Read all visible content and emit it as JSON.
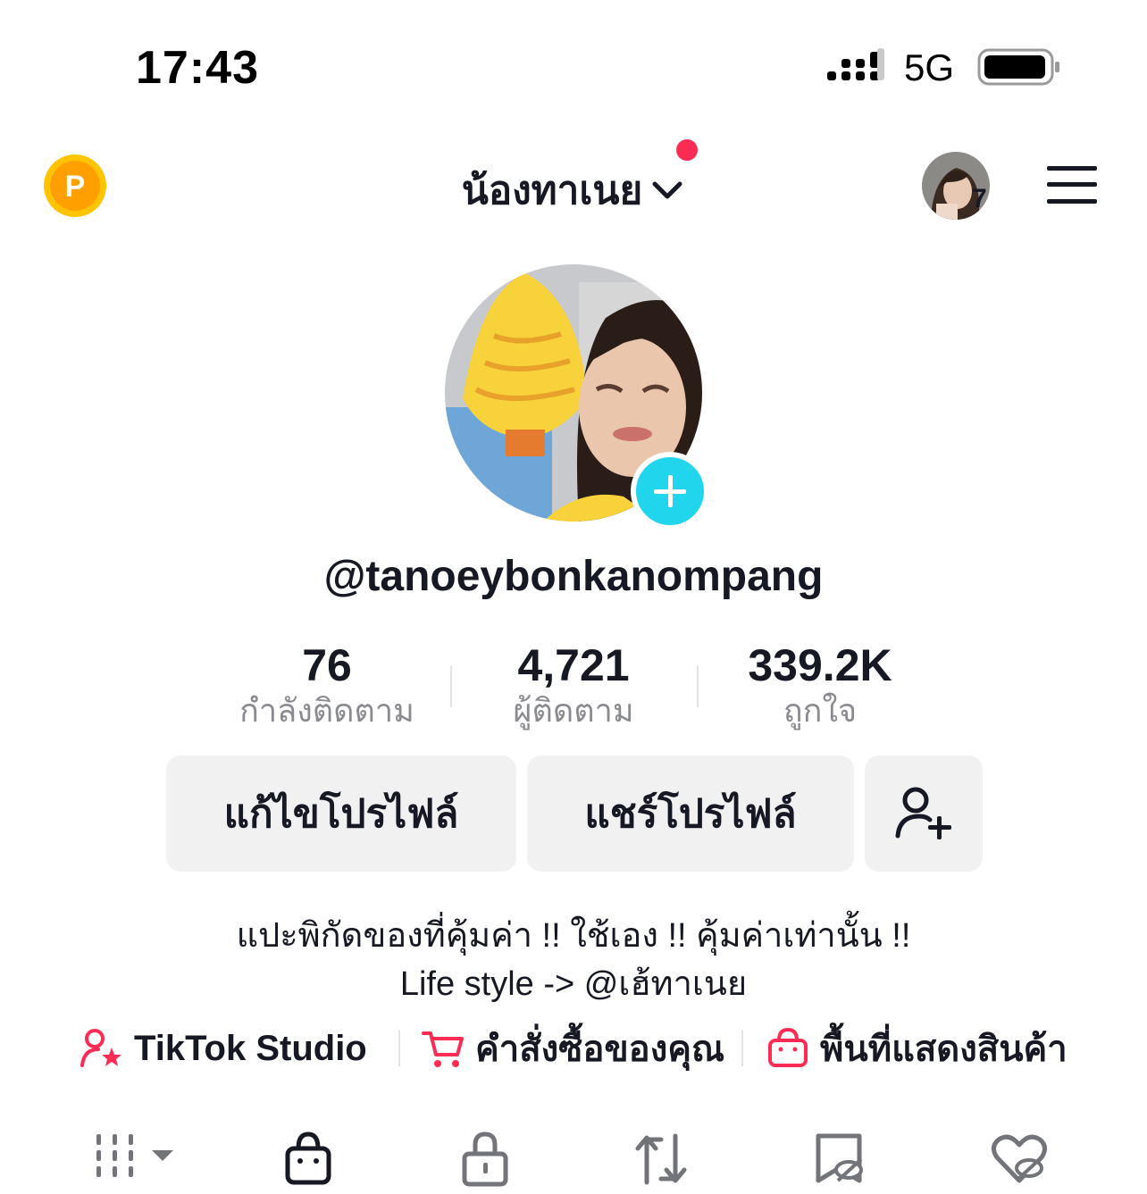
{
  "status_bar": {
    "time": "17:43",
    "network": "5G"
  },
  "header": {
    "account_name": "น้องทาเนย",
    "switch_account_count": "7"
  },
  "profile": {
    "username": "@tanoeybonkanompang",
    "stats": [
      {
        "value": "76",
        "label": "กำลังติดตาม"
      },
      {
        "value": "4,721",
        "label": "ผู้ติดตาม"
      },
      {
        "value": "339.2K",
        "label": "ถูกใจ"
      }
    ],
    "buttons": {
      "edit_profile": "แก้ไขโปรไฟล์",
      "share_profile": "แชร์โปรไฟล์"
    },
    "bio": {
      "line1": "แปะพิกัดของที่คุ้มค่า !! ใช้เอง !! คุ้มค่าเท่านั้น !!",
      "line2": "Life style -> @เฮ้ทาเนย"
    }
  },
  "quick_links": [
    {
      "label": "TikTok Studio",
      "icon": "creator-star-icon"
    },
    {
      "label": "คำสั่งซื้อของคุณ",
      "icon": "cart-icon"
    },
    {
      "label": "พื้นที่แสดงสินค้า",
      "icon": "shop-bag-icon"
    }
  ],
  "tabs": [
    "videos-grid-icon",
    "shop-bag-icon",
    "private-lock-icon",
    "repost-icon",
    "favorites-icon",
    "liked-hidden-icon"
  ],
  "colors": {
    "accent_red": "#fe2c55",
    "avatar_add_cyan": "#20d5ec",
    "points_gold": "#f7a800",
    "secondary_text": "#8a8b91",
    "button_bg": "#f1f1f2"
  }
}
